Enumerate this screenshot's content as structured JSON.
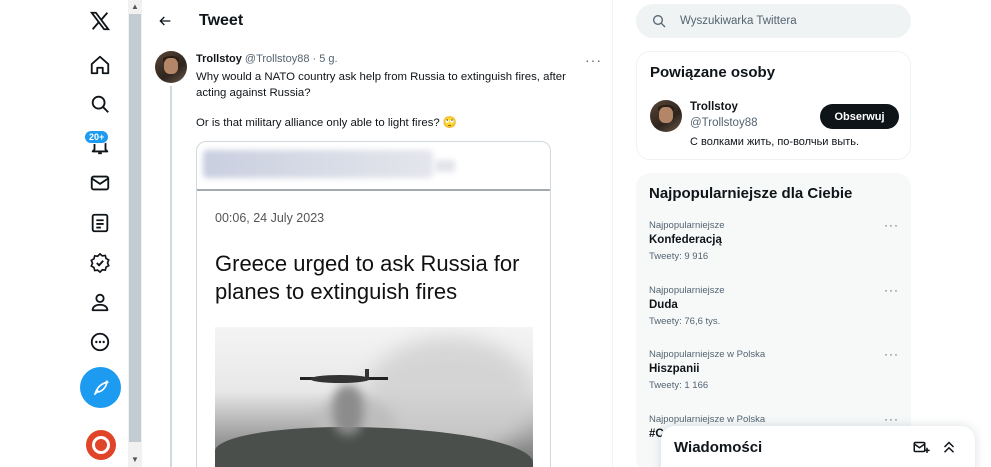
{
  "nav": {
    "notifications_badge": "20+"
  },
  "header": {
    "title": "Tweet"
  },
  "tweet": {
    "author_name": "Trollstoy",
    "author_meta": "@Trollstoy88 · 5 g.",
    "text_1": "Why would a NATO country ask help from Russia to extinguish fires, after acting against Russia?",
    "text_2": "Or is that military alliance only able to light fires? 🙄",
    "card": {
      "date": "00:06, 24 July 2023",
      "headline": "Greece urged to ask Russia for planes to extinguish fires"
    }
  },
  "search": {
    "placeholder": "Wyszukiwarka Twittera"
  },
  "related": {
    "title": "Powiązane osoby",
    "name": "Trollstoy",
    "handle": "@Trollstoy88",
    "bio": "С волками жить, по-волчьи выть.",
    "follow_label": "Obserwuj"
  },
  "trends": {
    "title": "Najpopularniejsze dla Ciebie",
    "items": [
      {
        "context": "Najpopularniejsze",
        "name": "Konfederacją",
        "count": "Tweety: 9 916"
      },
      {
        "context": "Najpopularniejsze",
        "name": "Duda",
        "count": "Tweety: 76,6 tys."
      },
      {
        "context": "Najpopularniejsze w Polska",
        "name": "Hiszpanii",
        "count": "Tweety: 1 166"
      },
      {
        "context": "Najpopularniejsze w Polska",
        "name": "#C",
        "count": ""
      }
    ]
  },
  "messages": {
    "title": "Wiadomości"
  }
}
